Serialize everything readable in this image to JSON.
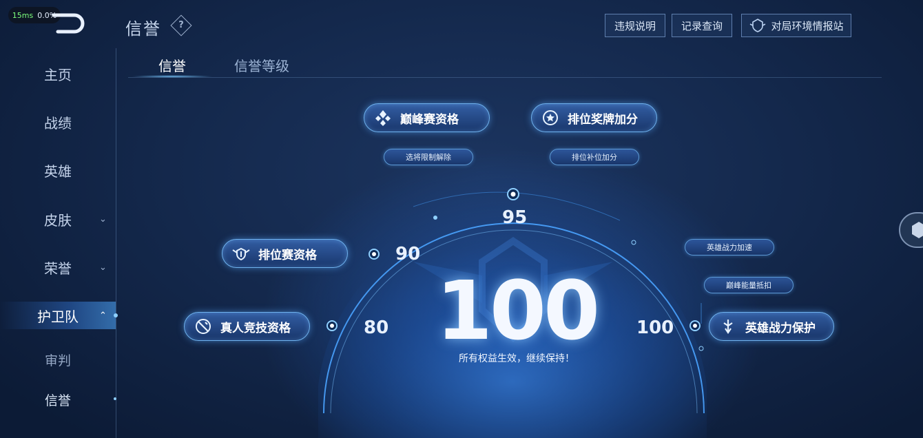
{
  "debug": {
    "frame_time": "15ms",
    "loss": "0.0%"
  },
  "header": {
    "title": "信誉",
    "help_glyph": "?",
    "buttons": {
      "violation": "违规说明",
      "records": "记录查询",
      "environment": "对局环境情报站"
    }
  },
  "sidebar": {
    "items": [
      {
        "label": "主页"
      },
      {
        "label": "战绩"
      },
      {
        "label": "英雄"
      },
      {
        "label": "皮肤",
        "chevron": "⌄"
      },
      {
        "label": "荣誉",
        "chevron": "⌄"
      },
      {
        "label": "护卫队",
        "chevron": "⌃"
      },
      {
        "label": "审判"
      },
      {
        "label": "信誉"
      }
    ]
  },
  "tabs": [
    {
      "label": "信誉"
    },
    {
      "label": "信誉等级"
    }
  ],
  "benefits": {
    "peak": {
      "label": "巅峰赛资格",
      "sub": "选将限制解除"
    },
    "ranked_medal": {
      "label": "排位奖牌加分",
      "sub": "排位补位加分"
    },
    "ranked": {
      "label": "排位赛资格"
    },
    "real_person": {
      "label": "真人竞技资格"
    },
    "hero_protect": {
      "label": "英雄战力保护",
      "subs": [
        "英雄战力加速",
        "巅峰能量抵扣"
      ]
    }
  },
  "thresholds": {
    "t80": "80",
    "t90": "90",
    "t95": "95",
    "t100": "100"
  },
  "score": {
    "value": "100",
    "status": "所有权益生效，继续保持！"
  },
  "colors": {
    "accent": "#6fb2ee",
    "background": "#13274a"
  }
}
